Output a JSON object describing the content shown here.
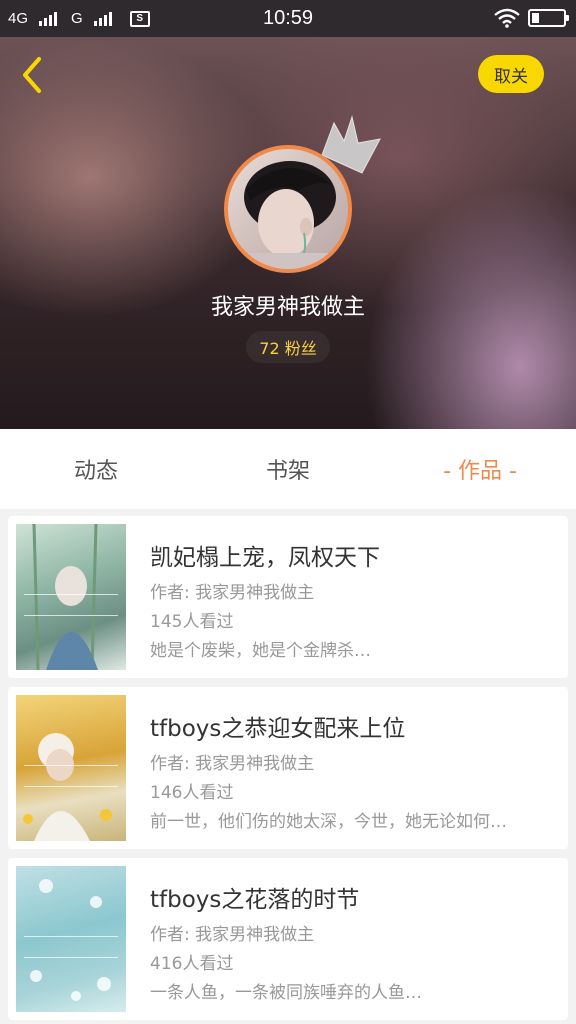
{
  "status_bar": {
    "network_1": "4G",
    "network_2": "G",
    "time": "10:59",
    "sim_icon": "S"
  },
  "header": {
    "unfollow_label": "取关",
    "username": "我家男神我做主",
    "fans_label": "72 粉丝"
  },
  "tabs": [
    {
      "label": "动态",
      "active": false
    },
    {
      "label": "书架",
      "active": false
    },
    {
      "label": "- 作品 -",
      "active": true
    }
  ],
  "books": [
    {
      "title": "凯妃榻上宠，凤权天下",
      "author": "作者: 我家男神我做主",
      "views": "145人看过",
      "desc": "她是个废柴，她是个金牌杀…"
    },
    {
      "title": "tfboys之恭迎女配来上位",
      "author": "作者: 我家男神我做主",
      "views": "146人看过",
      "desc": "前一世，他们伤的她太深，今世，她无论如何…"
    },
    {
      "title": "tfboys之花落的时节",
      "author": "作者: 我家男神我做主",
      "views": "416人看过",
      "desc": "一条人鱼，一条被同族唾弃的人鱼…"
    }
  ],
  "colors": {
    "accent": "#f0894d",
    "unfollow_bg": "#f8d800",
    "fans_text": "#f8d040"
  }
}
